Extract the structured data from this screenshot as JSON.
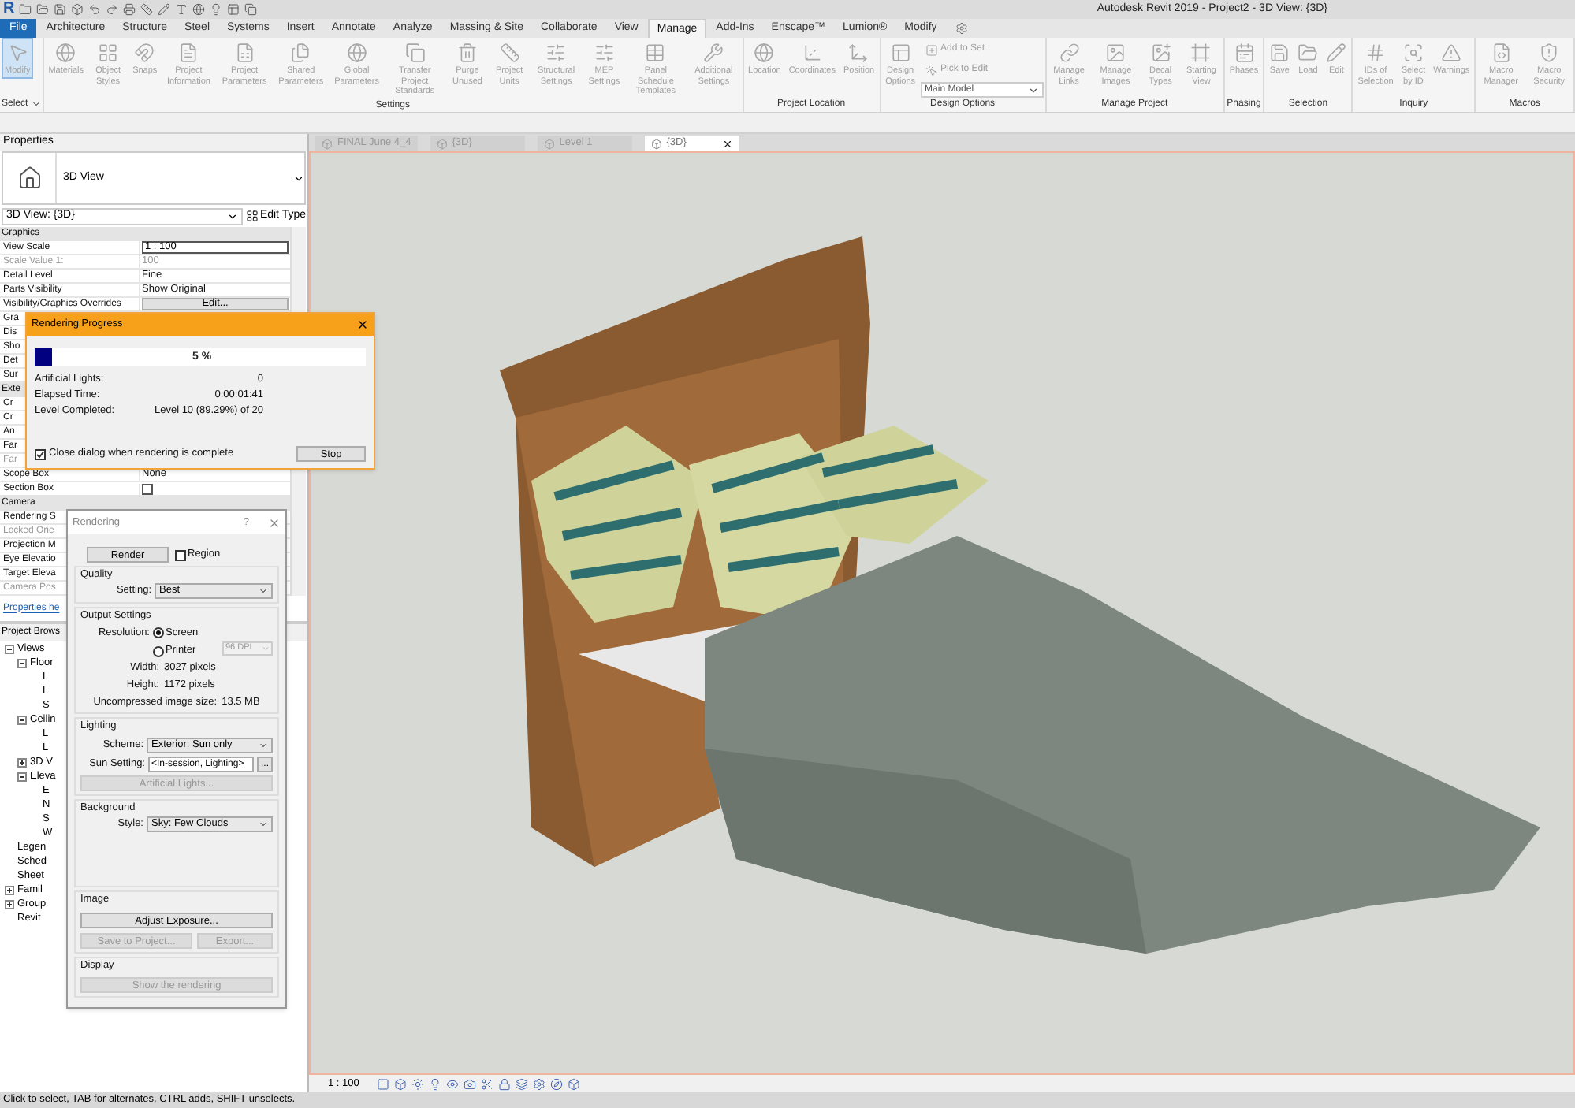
{
  "title_bar": {
    "logo": "R",
    "title": "Autodesk Revit 2019 - Project2 - 3D View: {3D}"
  },
  "ribbon_tabs": [
    {
      "label": "File",
      "kind": "file",
      "selected": false
    },
    {
      "label": "Architecture",
      "kind": "tab",
      "selected": false
    },
    {
      "label": "Structure",
      "kind": "tab",
      "selected": false
    },
    {
      "label": "Steel",
      "kind": "tab",
      "selected": false
    },
    {
      "label": "Systems",
      "kind": "tab",
      "selected": false
    },
    {
      "label": "Insert",
      "kind": "tab",
      "selected": false
    },
    {
      "label": "Annotate",
      "kind": "tab",
      "selected": false
    },
    {
      "label": "Analyze",
      "kind": "tab",
      "selected": false
    },
    {
      "label": "Massing & Site",
      "kind": "tab",
      "selected": false
    },
    {
      "label": "Collaborate",
      "kind": "tab",
      "selected": false
    },
    {
      "label": "View",
      "kind": "tab",
      "selected": false
    },
    {
      "label": "Manage",
      "kind": "tab",
      "selected": true
    },
    {
      "label": "Add-Ins",
      "kind": "tab",
      "selected": false
    },
    {
      "label": "Enscape™",
      "kind": "tab",
      "selected": false
    },
    {
      "label": "Lumion®",
      "kind": "tab",
      "selected": false
    },
    {
      "label": "Modify",
      "kind": "tab",
      "selected": false
    }
  ],
  "ribbon_panels": [
    {
      "title": "Select",
      "dropdown": true,
      "tools": [
        {
          "kind": "large",
          "label": "Modify",
          "selected": true
        }
      ]
    },
    {
      "title": "Settings",
      "dropdown": false,
      "tools": [
        {
          "kind": "large",
          "label": "Materials",
          "selected": false
        },
        {
          "kind": "large",
          "label": "Object Styles",
          "selected": false
        },
        {
          "kind": "large",
          "label": "Snaps",
          "selected": false
        },
        {
          "kind": "large",
          "label": "Project Information",
          "selected": false
        },
        {
          "kind": "large",
          "label": "Project Parameters",
          "selected": false
        },
        {
          "kind": "large",
          "label": "Shared Parameters",
          "selected": false
        },
        {
          "kind": "large",
          "label": "Global Parameters",
          "selected": false
        },
        {
          "kind": "large",
          "label": "Transfer Project Standards",
          "selected": false
        },
        {
          "kind": "large",
          "label": "Purge Unused",
          "selected": false
        },
        {
          "kind": "large",
          "label": "Project Units",
          "selected": false
        },
        {
          "kind": "large",
          "label": "Structural Settings",
          "selected": false
        },
        {
          "kind": "large",
          "label": "MEP Settings",
          "selected": false
        },
        {
          "kind": "large",
          "label": "Panel Schedule Templates",
          "selected": false
        },
        {
          "kind": "large",
          "label": "Additional Settings",
          "selected": false
        }
      ]
    },
    {
      "title": "Project Location",
      "dropdown": false,
      "tools": [
        {
          "kind": "large",
          "label": "Location",
          "selected": false
        },
        {
          "kind": "large",
          "label": "Coordinates",
          "selected": false
        },
        {
          "kind": "large",
          "label": "Position",
          "selected": false
        }
      ]
    },
    {
      "title": "Design Options",
      "dropdown": false,
      "tools": [
        {
          "kind": "large",
          "label": "Design Options",
          "selected": false
        },
        {
          "kind": "small",
          "label": "Add to Set",
          "selected": false
        },
        {
          "kind": "small",
          "label": "Pick to Edit",
          "selected": false
        },
        {
          "kind": "select",
          "label": "Main Model",
          "selected": false
        }
      ]
    },
    {
      "title": "Manage Project",
      "dropdown": false,
      "tools": [
        {
          "kind": "large",
          "label": "Manage Links",
          "selected": false
        },
        {
          "kind": "large",
          "label": "Manage Images",
          "selected": false
        },
        {
          "kind": "large",
          "label": "Decal Types",
          "selected": false
        },
        {
          "kind": "large",
          "label": "Starting View",
          "selected": false
        }
      ]
    },
    {
      "title": "Phasing",
      "dropdown": false,
      "tools": [
        {
          "kind": "large",
          "label": "Phases",
          "selected": false
        }
      ]
    },
    {
      "title": "Selection",
      "dropdown": false,
      "tools": [
        {
          "kind": "large",
          "label": "Save",
          "selected": false
        },
        {
          "kind": "large",
          "label": "Load",
          "selected": false
        },
        {
          "kind": "large",
          "label": "Edit",
          "selected": false
        }
      ]
    },
    {
      "title": "Inquiry",
      "dropdown": false,
      "tools": [
        {
          "kind": "large",
          "label": "IDs of Selection",
          "selected": false
        },
        {
          "kind": "large",
          "label": "Select by ID",
          "selected": false
        },
        {
          "kind": "large",
          "label": "Warnings",
          "selected": false
        }
      ]
    },
    {
      "title": "Macros",
      "dropdown": false,
      "tools": [
        {
          "kind": "large",
          "label": "Macro Manager",
          "selected": false
        },
        {
          "kind": "large",
          "label": "Macro Security",
          "selected": false
        }
      ]
    }
  ],
  "properties": {
    "title": "Properties",
    "type_name": "3D View",
    "type_selector": "3D View: {3D}",
    "edit_type": "Edit Type",
    "rows": [
      {
        "kind": "group",
        "label": "Graphics",
        "disabled": false
      },
      {
        "kind": "field",
        "label": "View Scale",
        "value": "1 : 100",
        "disabled": false
      },
      {
        "kind": "text",
        "label": "Scale Value 1:",
        "value": "100",
        "disabled": true
      },
      {
        "kind": "text",
        "label": "Detail Level",
        "value": "Fine",
        "disabled": false
      },
      {
        "kind": "text",
        "label": "Parts Visibility",
        "value": "Show Original",
        "disabled": false
      },
      {
        "kind": "button",
        "label": "Visibility/Graphics Overrides",
        "value": "Edit...",
        "disabled": false
      },
      {
        "kind": "text",
        "label": "Gra",
        "disabled": false
      },
      {
        "kind": "text",
        "label": "Dis",
        "disabled": false
      },
      {
        "kind": "text",
        "label": "Sho",
        "disabled": false
      },
      {
        "kind": "text",
        "label": "Det",
        "disabled": false
      },
      {
        "kind": "text",
        "label": "Sur",
        "disabled": false
      },
      {
        "kind": "group",
        "label": "Exte",
        "disabled": false
      },
      {
        "kind": "text",
        "label": "Cr",
        "disabled": false
      },
      {
        "kind": "text",
        "label": "Cr",
        "disabled": false
      },
      {
        "kind": "text",
        "label": "An",
        "disabled": false
      },
      {
        "kind": "text",
        "label": "Far",
        "disabled": false
      },
      {
        "kind": "text",
        "label": "Far",
        "disabled": true
      },
      {
        "kind": "text",
        "label": "Scope Box",
        "value": "None",
        "disabled": false
      },
      {
        "kind": "checkbox",
        "label": "Section Box",
        "checked": false,
        "disabled": false
      },
      {
        "kind": "group",
        "label": "Camera",
        "disabled": false
      },
      {
        "kind": "text",
        "label": "Rendering S",
        "disabled": false
      },
      {
        "kind": "text",
        "label": "Locked Orie",
        "disabled": true
      },
      {
        "kind": "text",
        "label": "Projection M",
        "disabled": false
      },
      {
        "kind": "text",
        "label": "Eye Elevatio",
        "disabled": false
      },
      {
        "kind": "text",
        "label": "Target Eleva",
        "disabled": false
      },
      {
        "kind": "text",
        "label": "Camera Pos",
        "disabled": true
      }
    ],
    "help_link": "Properties he"
  },
  "project_browser": {
    "title": "Project Brows",
    "tree": [
      {
        "label": "Views",
        "expanded": true,
        "children": [
          {
            "label": "Floor",
            "expanded": true,
            "children": [
              {
                "label": "L"
              },
              {
                "label": "L"
              },
              {
                "label": "S"
              }
            ]
          },
          {
            "label": "Ceilin",
            "expanded": true,
            "children": [
              {
                "label": "L"
              },
              {
                "label": "L"
              }
            ]
          },
          {
            "label": "3D V",
            "expanded": false
          },
          {
            "label": "Eleva",
            "expanded": true,
            "children": [
              {
                "label": "E"
              },
              {
                "label": "N"
              },
              {
                "label": "S"
              },
              {
                "label": "W"
              }
            ]
          }
        ]
      },
      {
        "label": "Legen"
      },
      {
        "label": "Sched"
      },
      {
        "label": "Sheet"
      },
      {
        "label": "Famil",
        "expanded": false
      },
      {
        "label": "Group",
        "expanded": false
      },
      {
        "label": "Revit"
      }
    ]
  },
  "view_tabs": [
    {
      "label": "FINAL June 4_4",
      "selected": false
    },
    {
      "label": "{3D}",
      "selected": false
    },
    {
      "label": "Level 1",
      "selected": false
    },
    {
      "label": "{3D}",
      "selected": true
    }
  ],
  "view_scale": "1 : 100",
  "status_bar": "Click to select, TAB for alternates, CTRL adds, SHIFT unselects.",
  "rendering_progress": {
    "title": "Rendering Progress",
    "level": 0.05,
    "percent": "5 %",
    "rows": [
      {
        "label": "Artificial Lights:",
        "value": "0"
      },
      {
        "label": "Elapsed Time:",
        "value": "0:00:01:41"
      },
      {
        "label": "Level Completed:",
        "value": "Level 10 (89.29%) of 20"
      }
    ],
    "close_option": {
      "label": "Close dialog when rendering is complete",
      "checked": true
    },
    "stop": "Stop"
  },
  "rendering": {
    "title": "Rendering",
    "help": "?",
    "render": "Render",
    "region": {
      "label": "Region",
      "checked": false
    },
    "quality": {
      "title": "Quality",
      "setting_label": "Setting:",
      "setting": "Best"
    },
    "output": {
      "title": "Output Settings",
      "resolution_label": "Resolution:",
      "options": [
        {
          "label": "Screen",
          "selected": true
        },
        {
          "label": "Printer",
          "selected": false
        }
      ],
      "dpi": "96 DPI",
      "width_label": "Width:",
      "width": "3027 pixels",
      "height_label": "Height:",
      "height": "1172 pixels",
      "size_label": "Uncompressed image size:",
      "size": "13.5 MB"
    },
    "lighting": {
      "title": "Lighting",
      "scheme_label": "Scheme:",
      "scheme": "Exterior: Sun only",
      "sun_label": "Sun Setting:",
      "sun": "<In-session, Lighting>",
      "more": "...",
      "artificial": "Artificial Lights..."
    },
    "background": {
      "title": "Background",
      "style_label": "Style:",
      "style": "Sky: Few Clouds"
    },
    "image": {
      "title": "Image",
      "adjust": "Adjust Exposure...",
      "save": "Save to Project...",
      "export": "Export..."
    },
    "display": {
      "title": "Display",
      "show": "Show the rendering"
    }
  }
}
